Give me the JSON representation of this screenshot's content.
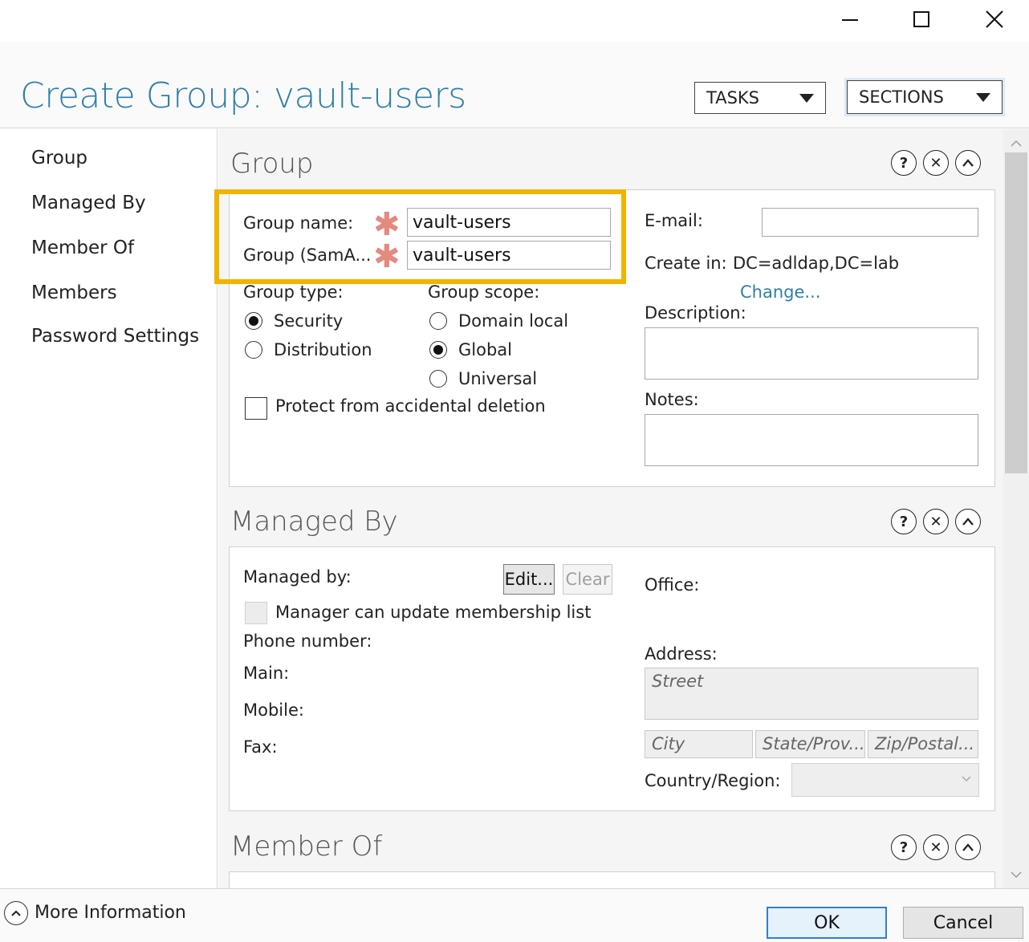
{
  "window": {
    "minimize_icon": "minimize-icon",
    "maximize_icon": "maximize-icon",
    "close_icon": "close-icon"
  },
  "header": {
    "title": "Create Group: vault-users",
    "tasks_label": "TASKS",
    "sections_label": "SECTIONS"
  },
  "nav": {
    "items": [
      {
        "label": "Group"
      },
      {
        "label": "Managed By"
      },
      {
        "label": "Member Of"
      },
      {
        "label": "Members"
      },
      {
        "label": "Password Settings"
      }
    ]
  },
  "group": {
    "title": "Group",
    "group_name_label": "Group name:",
    "group_name_value": "vault-users",
    "sam_label": "Group (SamA...",
    "sam_value": "vault-users",
    "required_mark": "✱",
    "email_label": "E-mail:",
    "email_value": "",
    "create_in_label": "Create in:",
    "create_in_value": "DC=adldap,DC=lab",
    "change_link": "Change...",
    "description_label": "Description:",
    "notes_label": "Notes:",
    "group_type_label": "Group type:",
    "type_options": [
      {
        "label": "Security",
        "selected": true
      },
      {
        "label": "Distribution",
        "selected": false
      }
    ],
    "group_scope_label": "Group scope:",
    "scope_options": [
      {
        "label": "Domain local",
        "selected": false
      },
      {
        "label": "Global",
        "selected": true
      },
      {
        "label": "Universal",
        "selected": false
      }
    ],
    "protect_label": "Protect from accidental deletion",
    "protect_checked": false
  },
  "managed_by": {
    "title": "Managed By",
    "managed_by_label": "Managed by:",
    "edit_label": "Edit...",
    "clear_label": "Clear",
    "manager_update_label": "Manager can update membership list",
    "phone_label": "Phone number:",
    "main_label": "Main:",
    "mobile_label": "Mobile:",
    "fax_label": "Fax:",
    "office_label": "Office:",
    "address_label": "Address:",
    "street_placeholder": "Street",
    "city_placeholder": "City",
    "state_placeholder": "State/Prov...",
    "zip_placeholder": "Zip/Postal...",
    "country_label": "Country/Region:"
  },
  "member_of": {
    "title": "Member Of"
  },
  "section_icons": {
    "help": "?",
    "close": "✕",
    "collapse": "^"
  },
  "footer": {
    "more_info_label": "More Information",
    "ok_label": "OK",
    "cancel_label": "Cancel"
  },
  "colors": {
    "accent": "#2f7fa8",
    "highlight": "#f0b400",
    "required": "#e48a7e"
  }
}
